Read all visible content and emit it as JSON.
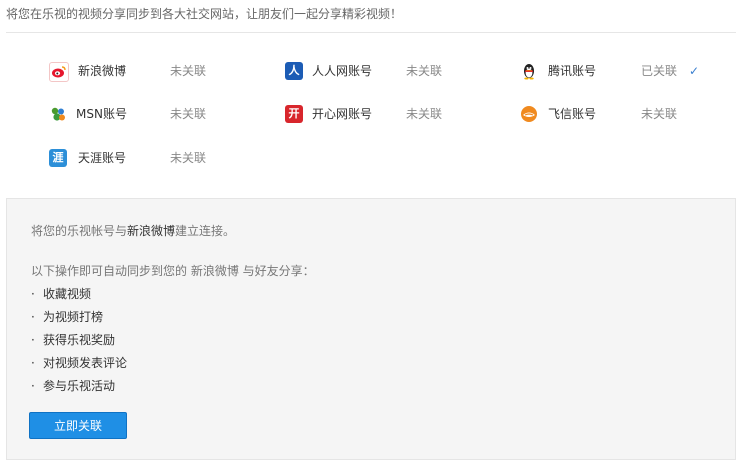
{
  "intro": "将您在乐视的视频分享同步到各大社交网站，让朋友们一起分享精彩视频！",
  "accounts": [
    {
      "name": "新浪微博",
      "status": "未关联",
      "icon": "sina-weibo-icon",
      "color": "#e6162d",
      "glyph": "◉"
    },
    {
      "name": "人人网账号",
      "status": "未关联",
      "icon": "renren-icon",
      "color": "#1c5cb5",
      "glyph": "人"
    },
    {
      "name": "腾讯账号",
      "status": "已关联",
      "icon": "qq-penguin-icon",
      "color": "#ffffff",
      "glyph": "🐧",
      "check": "✓"
    },
    {
      "name": "MSN账号",
      "status": "未关联",
      "icon": "msn-icon",
      "color": "#4a9a2e",
      "glyph": "✿"
    },
    {
      "name": "开心网账号",
      "status": "未关联",
      "icon": "kaixin-icon",
      "color": "#d8262c",
      "glyph": "开"
    },
    {
      "name": "飞信账号",
      "status": "未关联",
      "icon": "fetion-icon",
      "color": "#f08a1f",
      "glyph": "◕"
    },
    {
      "name": "天涯账号",
      "status": "未关联",
      "icon": "tianya-icon",
      "color": "#2c8fd8",
      "glyph": "涯"
    }
  ],
  "panel": {
    "line1_prefix": "将您的乐视帐号与",
    "line1_highlight": "新浪微博",
    "line1_suffix": "建立连接。",
    "line2": "以下操作即可自动同步到您的  新浪微博  与好友分享：",
    "bullet": "·",
    "items": [
      "收藏视频",
      "为视频打榜",
      "获得乐视奖励",
      "对视频发表评论",
      "参与乐视活动"
    ],
    "button": "立即关联"
  }
}
